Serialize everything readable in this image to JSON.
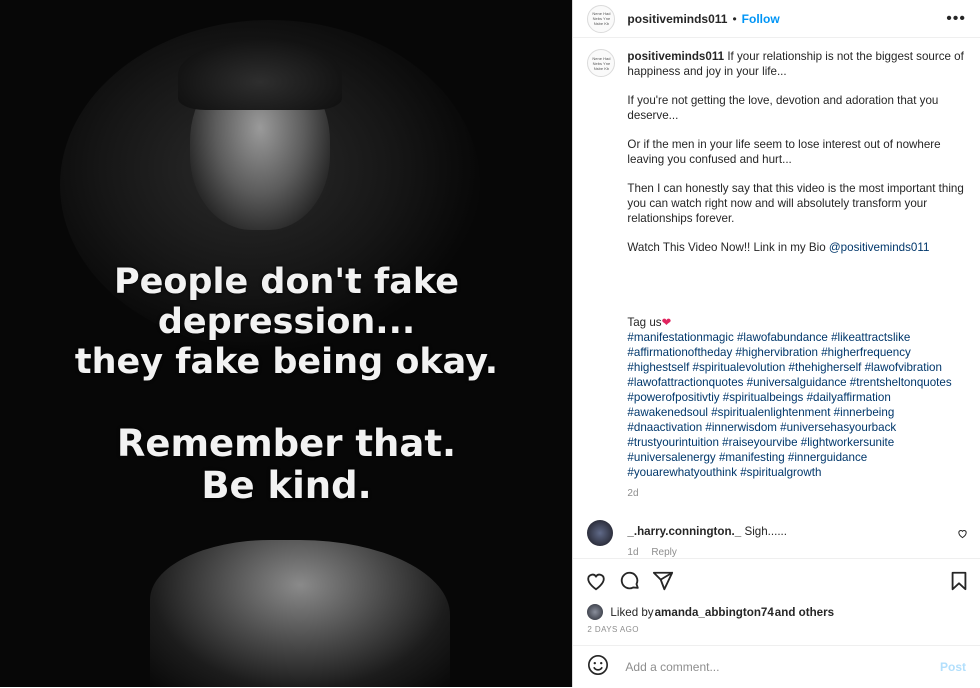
{
  "post": {
    "username": "positiveminds011",
    "follow_label": "Follow",
    "separator": "•",
    "more_label": "•••",
    "avatar_text": "Nene Had Nebs Yne Nsbe Kb",
    "image_quote": {
      "line1": "People don't fake depression...",
      "line2": "they fake being okay.",
      "line3": "Remember that.",
      "line4": "Be kind."
    },
    "caption": {
      "first": "If your relationship is not the biggest source of happiness and joy in your life...",
      "p2": "If you're not getting the love, devotion and adoration that you deserve...",
      "p3": "Or if the men in your life seem to lose interest out of nowhere leaving you confused and hurt...",
      "p4": "Then I can honestly say that this video is the most important thing you can watch right now and will absolutely transform your relationships forever.",
      "p5_text": "Watch This Video Now!! Link in my Bio ",
      "p5_mention": "@positiveminds011",
      "tag_us": "Tag us",
      "hashtags": "#manifestationmagic #lawofabundance #likeattractslike #affirmationoftheday #highervibration #higherfrequency #highestself #spiritualevolution #thehigherself #lawofvibration #lawofattractionquotes #universalguidance #trentsheltonquotes #powerofpositivtiy #spiritualbeings #dailyaffirmation #awakenedsoul #spiritualenlightenment #innerbeing #dnaactivation #innerwisdom #universehasyourback #trustyourintuition #raiseyourvibe #lightworkersunite #universalenergy #manifesting #innerguidance #youarewhatyouthink #spiritualgrowth",
      "time": "2d"
    },
    "comment": {
      "username": "_.harry.connington._",
      "text": " Sigh......",
      "time": "1d",
      "reply": "Reply"
    },
    "likes": {
      "prefix": "Liked by ",
      "user": "amanda_abbington74",
      "suffix": " and others"
    },
    "posted_ago": "2 DAYS AGO",
    "add_comment_placeholder": "Add a comment...",
    "post_label": "Post"
  },
  "icons": [
    "heart-icon",
    "comment-icon",
    "share-icon",
    "bookmark-icon",
    "emoji-icon",
    "small-heart-icon",
    "more-icon"
  ]
}
